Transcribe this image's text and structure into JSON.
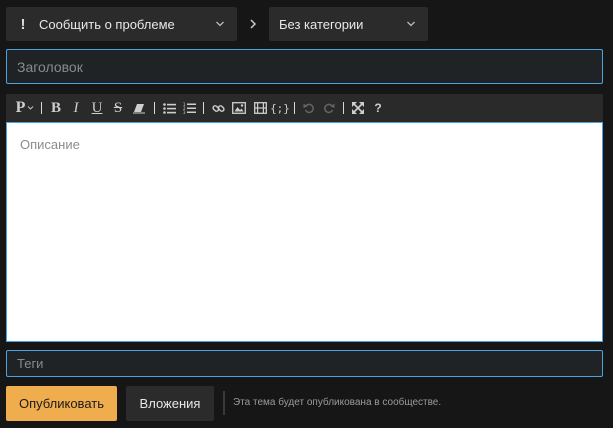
{
  "header": {
    "category": {
      "label": "Сообщить о проблеме",
      "icon": "exclamation-icon"
    },
    "subcategory": {
      "label": "Без категории"
    }
  },
  "title_field": {
    "placeholder": "Заголовок",
    "value": ""
  },
  "toolbar": {
    "paragraph_label": "P",
    "bold_label": "B",
    "italic_label": "I",
    "underline_label": "U",
    "strike_label": "S",
    "code_label": "{;}",
    "help_label": "?"
  },
  "editor": {
    "placeholder": "Описание"
  },
  "tags_field": {
    "placeholder": "Теги",
    "value": ""
  },
  "footer": {
    "publish_label": "Опубликовать",
    "attachments_label": "Вложения",
    "note": "Эта тема будет опубликована в сообществе."
  },
  "colors": {
    "accent": "#4aa3df",
    "publish": "#f0ad4e",
    "background": "#161616",
    "panel": "#2b2b2b"
  }
}
